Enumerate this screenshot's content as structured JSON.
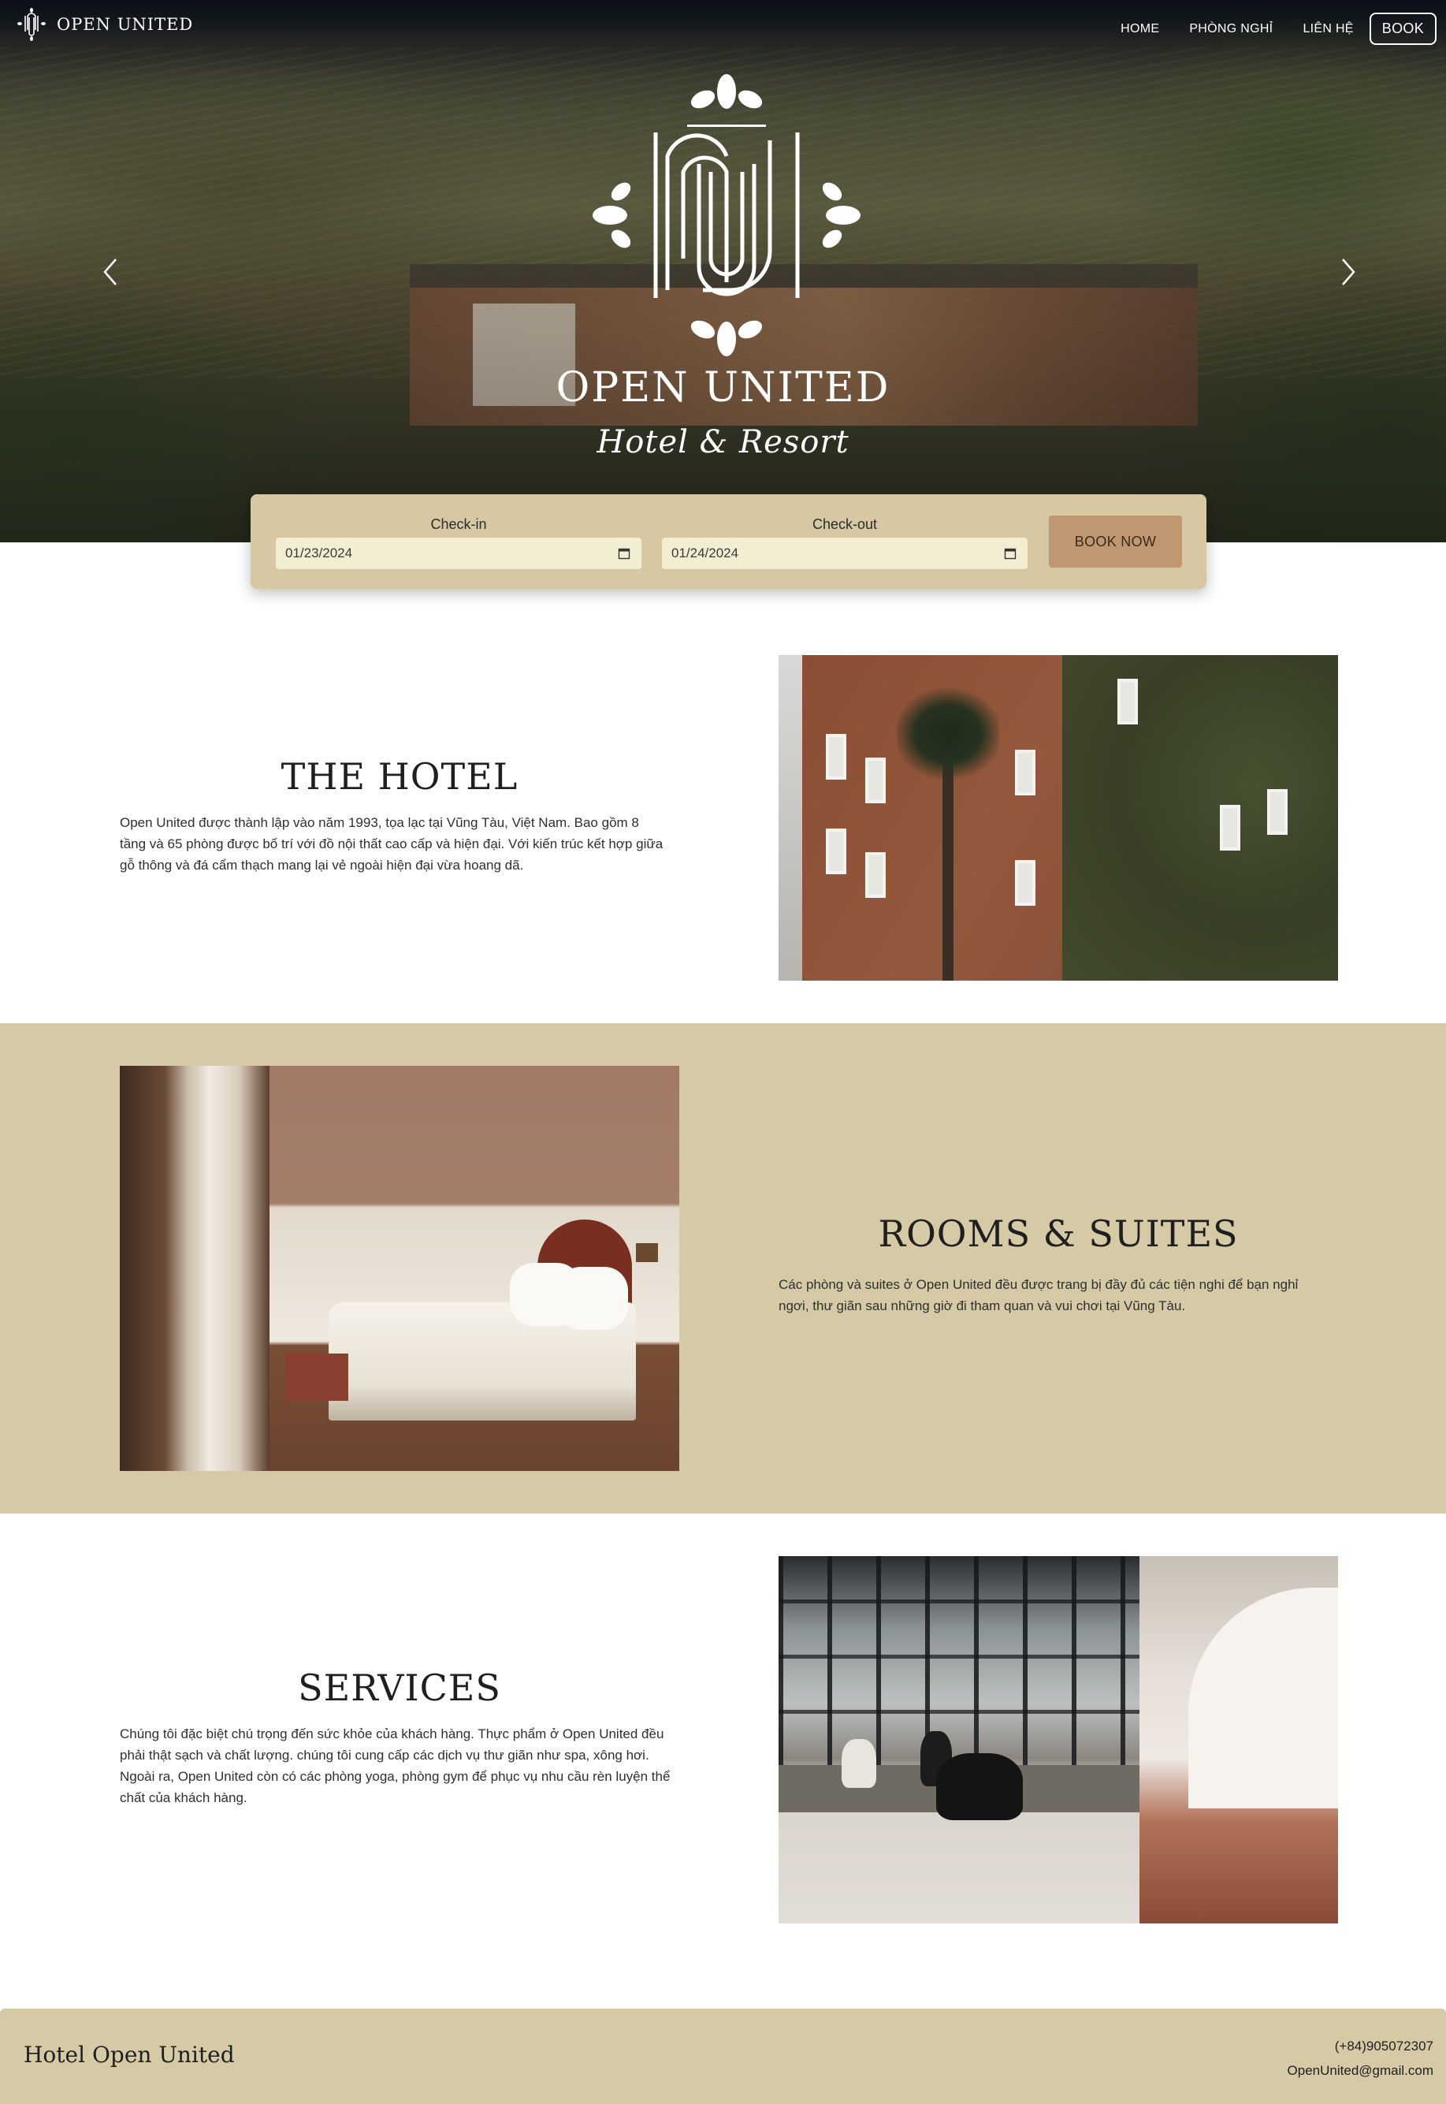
{
  "brand": {
    "name": "OPEN UNITED"
  },
  "nav": {
    "items": [
      "HOME",
      "PHÒNG NGHỈ",
      "LIÊN HỆ"
    ],
    "book_label": "BOOK"
  },
  "hero": {
    "title": "OPEN UNITED",
    "subtitle": "Hotel & Resort"
  },
  "booking": {
    "checkin_label": "Check-in",
    "checkin_value": "01/23/2024",
    "checkout_label": "Check-out",
    "checkout_value": "01/24/2024",
    "button_label": "BOOK NOW"
  },
  "sections": {
    "hotel": {
      "title": "THE HOTEL",
      "text": "Open United được thành lập vào năm 1993, tọa lạc tại Vũng Tàu, Việt Nam. Bao gồm 8 tầng và 65 phòng được bố trí với đồ nội thất cao cấp và hiện đại. Với kiến trúc kết hợp giữa gỗ thông và đá cẩm thạch mang lại vẻ ngoài hiện đại vừa hoang dã."
    },
    "rooms": {
      "title": "ROOMS  & SUITES",
      "text": "Các phòng và suites ở Open United đều được trang bị đầy đủ các tiện nghi để bạn nghỉ ngơi, thư giãn sau những giờ đi tham quan và vui chơi tại Vũng Tàu."
    },
    "services": {
      "title": "SERVICES",
      "text": "Chúng tôi đặc biệt chú trọng đến sức khỏe của khách hàng. Thực phẩm ở Open United đều phải thật sạch và chất lượng. chúng tôi cung cấp các dịch vụ thư giãn như spa, xông hơi. Ngoài ra, Open United còn có các phòng yoga, phòng gym để phục vụ nhu cầu rèn luyện thể chất của khách hàng."
    }
  },
  "footer": {
    "brand": "Hotel Open United",
    "phone": "(+84)905072307",
    "email": "OpenUnited@gmail.com"
  },
  "colors": {
    "sand": "#d6c9a6",
    "booking_bg": "#d6c8a2",
    "input_bg": "#f3edd2",
    "accent_button": "#bf9770"
  },
  "icons": {
    "brand": "hotel-monogram-icon",
    "prev": "chevron-left-icon",
    "next": "chevron-right-icon",
    "calendar": "calendar-icon"
  }
}
